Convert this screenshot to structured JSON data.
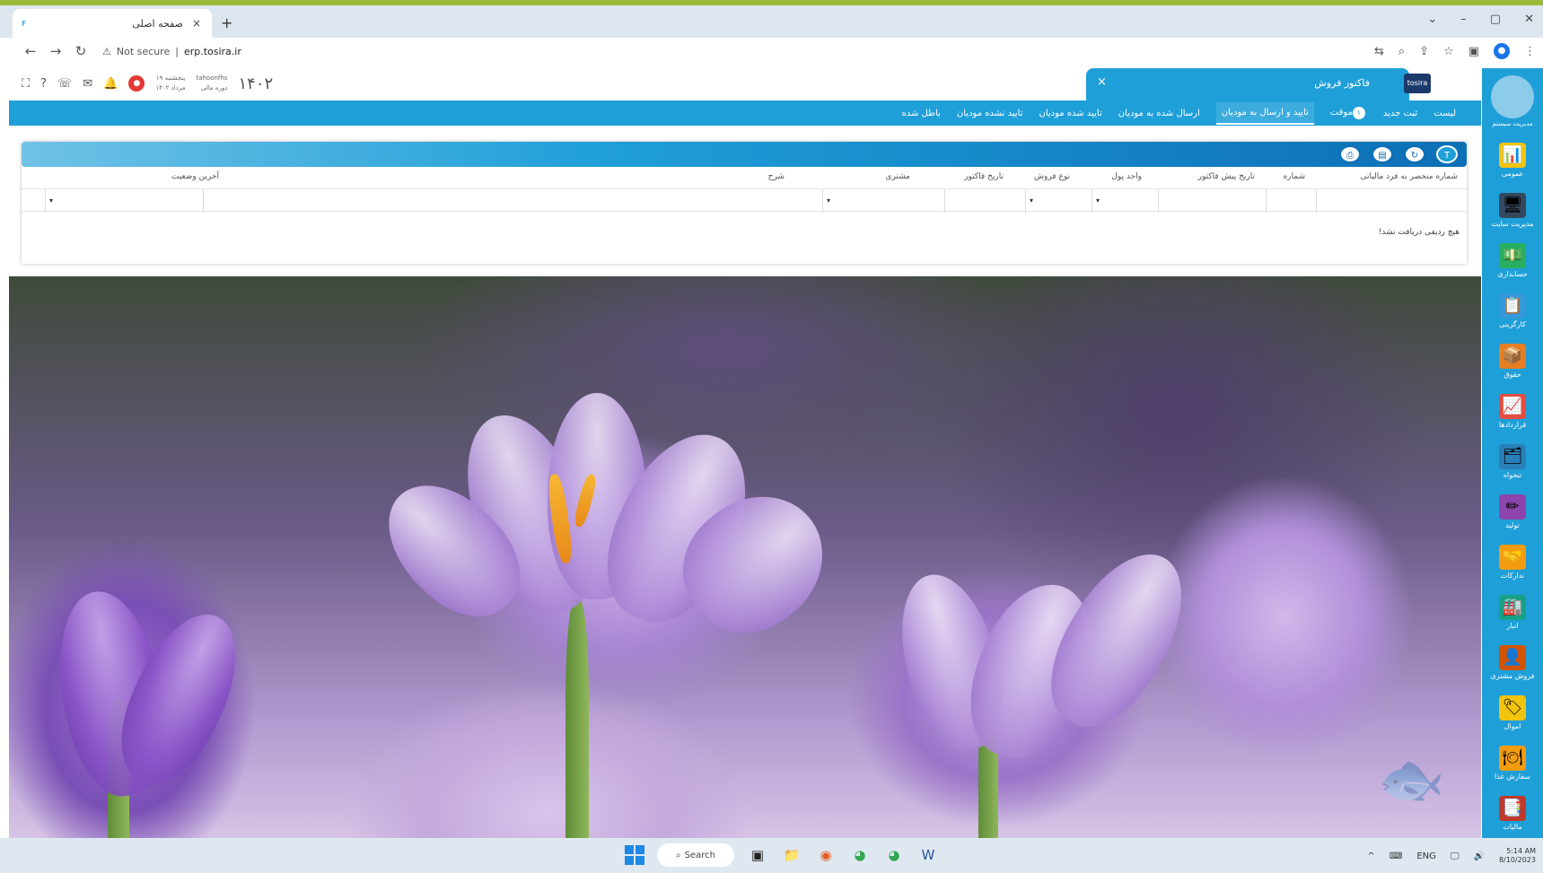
{
  "browser": {
    "tab_title": "صفحه اصلی",
    "url_warning": "Not secure",
    "url": "erp.tosira.ir",
    "new_tab": "+",
    "window_controls": [
      "⌄",
      "–",
      "▢",
      "✕"
    ]
  },
  "header": {
    "year": "۱۴۰۲",
    "period_label": "دوره مالی",
    "username": "tahoonfhs",
    "weekday": "پنجشنبه ۱۹",
    "month": "مرداد ۱۴۰۲",
    "notification_count": "●",
    "app_tab_title": "فاکتور فروش",
    "app_tab_close": "×",
    "logo_text": "tosira"
  },
  "nav": {
    "items": [
      {
        "label": "لیست"
      },
      {
        "label": "ثبت جدید"
      },
      {
        "label": "موقت",
        "badge": "۱"
      },
      {
        "label": "تایید و ارسال به مودیان",
        "active": true
      },
      {
        "label": "ارسال شده به مودیان"
      },
      {
        "label": "تایید شده مودیان"
      },
      {
        "label": "تایید نشده مودیان"
      },
      {
        "label": "باطل شده"
      }
    ]
  },
  "grid": {
    "columns": [
      "شماره منحصر به فرد مالیاتی",
      "شماره",
      "تاریخ پیش فاکتور",
      "واحد پول",
      "نوع فروش",
      "تاریخ فاکتور",
      "مشتری",
      "شرح",
      "آخرین وضعیت"
    ],
    "filter_arrow": "▾",
    "empty_message": "هیچ ردیفی دریافت نشد!"
  },
  "sidebar": {
    "user_label": "مدیریت سیستم",
    "items": [
      {
        "label": "عمومی",
        "icon": "📊",
        "color": "#f1c40f"
      },
      {
        "label": "مدیریت سایت",
        "icon": "🖥",
        "color": "#34495e"
      },
      {
        "label": "حسابداری",
        "icon": "💵",
        "color": "#27ae60"
      },
      {
        "label": "کارگزینی",
        "icon": "📋",
        "color": "#3498db"
      },
      {
        "label": "حقوق",
        "icon": "📦",
        "color": "#e67e22"
      },
      {
        "label": "قراردادها",
        "icon": "📈",
        "color": "#e74c3c"
      },
      {
        "label": "تنخواه",
        "icon": "🗂",
        "color": "#2980b9"
      },
      {
        "label": "تولید",
        "icon": "✏",
        "color": "#8e44ad"
      },
      {
        "label": "تدارکات",
        "icon": "🤝",
        "color": "#f39c12"
      },
      {
        "label": "انبار",
        "icon": "🏭",
        "color": "#16a085"
      },
      {
        "label": "فروش مشتری",
        "icon": "👤",
        "color": "#d35400"
      },
      {
        "label": "اموال",
        "icon": "🏷",
        "color": "#f1c40f"
      },
      {
        "label": "سفارش غذا",
        "icon": "🍽",
        "color": "#f39c12"
      },
      {
        "label": "مالیات",
        "icon": "📑",
        "color": "#c0392b"
      }
    ]
  },
  "taskbar": {
    "search_label": "Search",
    "lang": "ENG",
    "time": "5:14 AM",
    "date": "8/10/2023"
  }
}
